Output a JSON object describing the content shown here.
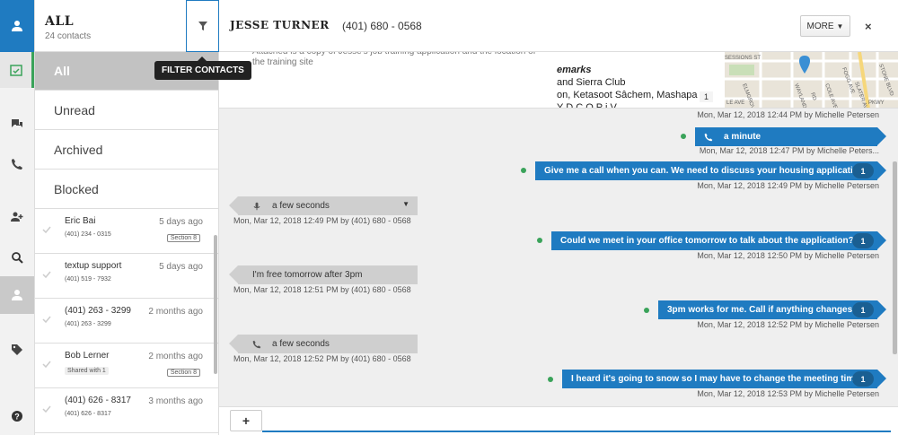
{
  "rail": {
    "items": [
      {
        "icon": "user-icon"
      },
      {
        "icon": "calendar-check-icon"
      },
      {
        "icon": "chat-icon"
      },
      {
        "icon": "phone-icon"
      },
      {
        "icon": "add-user-icon"
      },
      {
        "icon": "search-icon"
      },
      {
        "icon": "person-icon"
      },
      {
        "icon": "tags-icon"
      },
      {
        "icon": "help-icon"
      }
    ]
  },
  "panel": {
    "title": "ALL",
    "subtitle": "24 contacts",
    "filter_tooltip": "FILTER CONTACTS",
    "filters": [
      "All",
      "Unread",
      "Archived",
      "Blocked"
    ],
    "contacts": [
      {
        "name": "Eric Bai",
        "time": "5 days ago",
        "number": "(401) 234 - 0315",
        "tag": "Section 8"
      },
      {
        "name": "textup support",
        "time": "5 days ago",
        "number": "(401) 519 - 7932"
      },
      {
        "name": "(401) 263 - 3299",
        "time": "2 months ago",
        "number": "(401) 263 - 3299"
      },
      {
        "name": "Bob Lerner",
        "time": "2 months ago",
        "shared": "Shared with 1",
        "tag": "Section 8"
      },
      {
        "name": "(401) 626 - 8317",
        "time": "3 months ago",
        "number": "(401) 626 - 8317"
      }
    ]
  },
  "convo": {
    "name": "JESSE TURNER",
    "number": "(401) 680 - 0568",
    "more_label": "MORE",
    "close_label": "×",
    "note_text": "Attached is a copy of Jesse's job training application and the location of the training site",
    "doc_lines": [
      "emarks",
      "and Sierra Club",
      "on, Ketasoot Sâchem, Mashapa",
      "Y    D    C    O    P    i    V"
    ],
    "map_badge": "1",
    "map_labels": {
      "l1": "SESSIONS ST",
      "l2": "STONE BLVD",
      "l3": "ELMGROVE AVE",
      "l4": "WAYLAND AVE",
      "l5": "COLE AVE",
      "l6": "SLATER AVE",
      "l7": "FOGG AVE",
      "l8": "PKWY",
      "l9": "LE AVE",
      "l10": "RD"
    }
  },
  "messages": [
    {
      "dir": "meta",
      "meta": "Mon, Mar 12, 2018 12:44 PM by Michelle Petersen"
    },
    {
      "dir": "out",
      "kind": "call",
      "text": "a minute",
      "meta": "Mon, Mar 12, 2018 12:47 PM by Michelle Peters..."
    },
    {
      "dir": "out",
      "text": "Give me a call when you can. We need to discuss your housing application",
      "count": "1",
      "meta": "Mon, Mar 12, 2018 12:49 PM by Michelle Petersen"
    },
    {
      "dir": "in",
      "kind": "voicemail",
      "text": "a few seconds",
      "meta": "Mon, Mar 12, 2018 12:49 PM by (401) 680 - 0568"
    },
    {
      "dir": "out",
      "text": "Could we meet in your office tomorrow to talk about the application?",
      "count": "1",
      "meta": "Mon, Mar 12, 2018 12:50 PM by Michelle Petersen"
    },
    {
      "dir": "in",
      "text": "I'm free tomorrow after 3pm",
      "meta": "Mon, Mar 12, 2018 12:51 PM by (401) 680 - 0568"
    },
    {
      "dir": "out",
      "text": "3pm works for me. Call if anything changes",
      "count": "1",
      "meta": "Mon, Mar 12, 2018 12:52 PM by Michelle Petersen"
    },
    {
      "dir": "in",
      "kind": "call",
      "text": "a few seconds",
      "meta": "Mon, Mar 12, 2018 12:52 PM by (401) 680 - 0568"
    },
    {
      "dir": "out",
      "text": "I heard it's going to snow so I may have to change the meeting time",
      "count": "1",
      "meta": "Mon, Mar 12, 2018 12:53 PM by Michelle Petersen"
    }
  ],
  "composer": {
    "add_label": "+"
  },
  "colors": {
    "accent": "#1f7bc1",
    "status_dot": "#3aa35a",
    "incoming": "#cfcfcf"
  }
}
